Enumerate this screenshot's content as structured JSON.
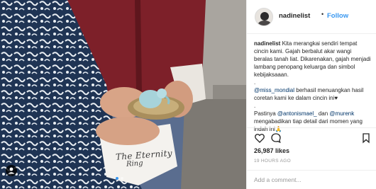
{
  "post": {
    "username": "nadinelist",
    "header_separator": "•",
    "follow_label": "Follow",
    "photo": {
      "watermark_line1": "The Eternity",
      "watermark_line2": "Ring",
      "tag_icon": "user-tag-icon",
      "carousel_pages": 2,
      "carousel_active_index": 0
    },
    "caption": {
      "username": "nadinelist",
      "text": " Kita merangkai sendiri tempat cincin kami. Gajah berbalut akar wangi beralas tanah liat. Dikarenakan, gajah menjadi lambang penopang keluarga dan simbol kebijaksaaan."
    },
    "lines": {
      "dot1": ".",
      "mention1": "@miss_mondial",
      "text1": " berhasil menuangkan hasil coretan kami ke dalam cincin ini",
      "heart": "♥",
      "dot2": ".",
      "text2a": "Pastinya ",
      "mention2": "@antonismael_",
      "text2b": " dan ",
      "mention3": "@murenk",
      "text2c": " mengabadikan tiap detail dari momen yang indah ini",
      "emoji2": "🙏"
    },
    "actions": {
      "like_icon": "heart-icon",
      "comment_icon": "comment-icon",
      "save_icon": "bookmark-icon"
    },
    "likes_label": "26,987 likes",
    "timestamp": "19 HOURS AGO",
    "comment_placeholder": "Add a comment..."
  },
  "colors": {
    "accent": "#3897f0",
    "mention": "#003569",
    "muted": "#999999",
    "text": "#262626",
    "border": "#efefef"
  }
}
